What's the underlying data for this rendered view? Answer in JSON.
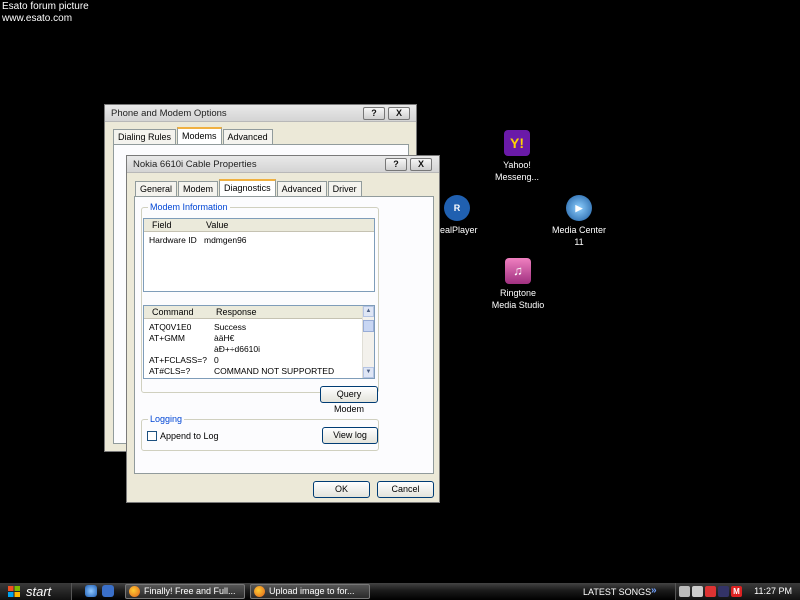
{
  "watermark": {
    "line1": "Esato forum picture",
    "line2": "www.esato.com"
  },
  "desktop_icons": [
    {
      "name": "Yahoo! Messenger",
      "label_line1": "Yahoo!",
      "label_line2": "Messeng...",
      "icon": "yahoo-icon"
    },
    {
      "name": "RealPlayer",
      "label_line1": "ealPlayer",
      "icon": "realplayer-icon"
    },
    {
      "name": "Media Center 11",
      "label_line1": "Media Center",
      "label_line2": "11",
      "icon": "media-center-icon"
    },
    {
      "name": "Ringtone Media Studio",
      "label_line1": "Ringtone",
      "label_line2": "Media Studio",
      "icon": "ringtone-icon"
    }
  ],
  "back_window": {
    "title": "Phone and Modem Options",
    "help_btn": "?",
    "close_btn": "X",
    "tabs": [
      "Dialing Rules",
      "Modems",
      "Advanced"
    ],
    "active_tab": "Modems"
  },
  "front_window": {
    "title": "Nokia 6610i Cable Properties",
    "help_btn": "?",
    "close_btn": "X",
    "tabs": [
      "General",
      "Modem",
      "Diagnostics",
      "Advanced",
      "Driver"
    ],
    "active_tab": "Diagnostics",
    "modem_info": {
      "group_title": "Modem Information",
      "columns": [
        "Field",
        "Value"
      ],
      "rows": [
        {
          "field": "Hardware ID",
          "value": "mdmgen96"
        }
      ]
    },
    "commands": {
      "columns": [
        "Command",
        "Response"
      ],
      "rows": [
        {
          "command": "ATQ0V1E0",
          "response": "Success"
        },
        {
          "command": "AT+GMM",
          "response": "àäH€"
        },
        {
          "command": "",
          "response": "àÐ+÷d6610i"
        },
        {
          "command": "AT+FCLASS=?",
          "response": "0"
        },
        {
          "command": "AT#CLS=?",
          "response": "COMMAND NOT SUPPORTED"
        }
      ]
    },
    "query_button": "Query Modem",
    "logging": {
      "group_title": "Logging",
      "append_label": "Append to Log",
      "append_checked": false,
      "view_log_button": "View log"
    },
    "ok_button": "OK",
    "cancel_button": "Cancel"
  },
  "taskbar": {
    "start_label": "start",
    "items": [
      "Finally! Free and Full...",
      "Upload image to for..."
    ],
    "latest_songs": "LATEST SONGS",
    "chevron": "»",
    "tray_letter": "M",
    "clock": "11:27 PM"
  },
  "colors": {
    "desktop": "#000000",
    "window_face": "#ece9d8",
    "group_title": "#0046d5",
    "active_tab_highlight": "#f0b040"
  }
}
